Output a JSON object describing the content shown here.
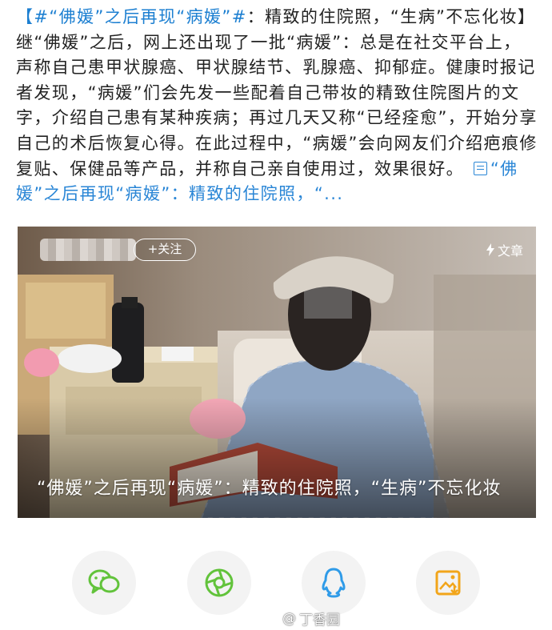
{
  "post": {
    "hashtag": "【#“佛媛”之后再现“病媛”#",
    "body": "：精致的住院照，“生病”不忘化妆】继“佛媛”之后，网上还出现了一批“病媛”：总是在社交平台上，声称自己患甲状腺癌、甲状腺结节、乳腺癌、抑郁症。健康时报记者发现，“病媛”们会先发一些配着自己带妆的精致住院图片的文字，介绍自己患有某种疾病；再过几天又称“已经痊愈”，开始分享自己的术后恢复心得。在此过程中，“病媛”会向网友们介绍疤痕修复贴、保健品等产品，并称自己亲自使用过，效果很好。",
    "card_link": "“佛媛”之后再现“病媛”：精致的住院照，“..."
  },
  "card": {
    "follow_label": "+关注",
    "article_label": "文章",
    "caption": "“佛媛”之后再现“病媛”：精致的住院照，“生病”不忘化妆"
  },
  "share": [
    {
      "name": "wechat-icon",
      "color": "#62c33b"
    },
    {
      "name": "moments-icon",
      "color": "#62c33b"
    },
    {
      "name": "qq-icon",
      "color": "#2f9be8"
    },
    {
      "name": "save-image-icon",
      "color": "#f2a51a"
    }
  ],
  "watermark": {
    "at_icon": "@",
    "handle": "丁香园"
  }
}
